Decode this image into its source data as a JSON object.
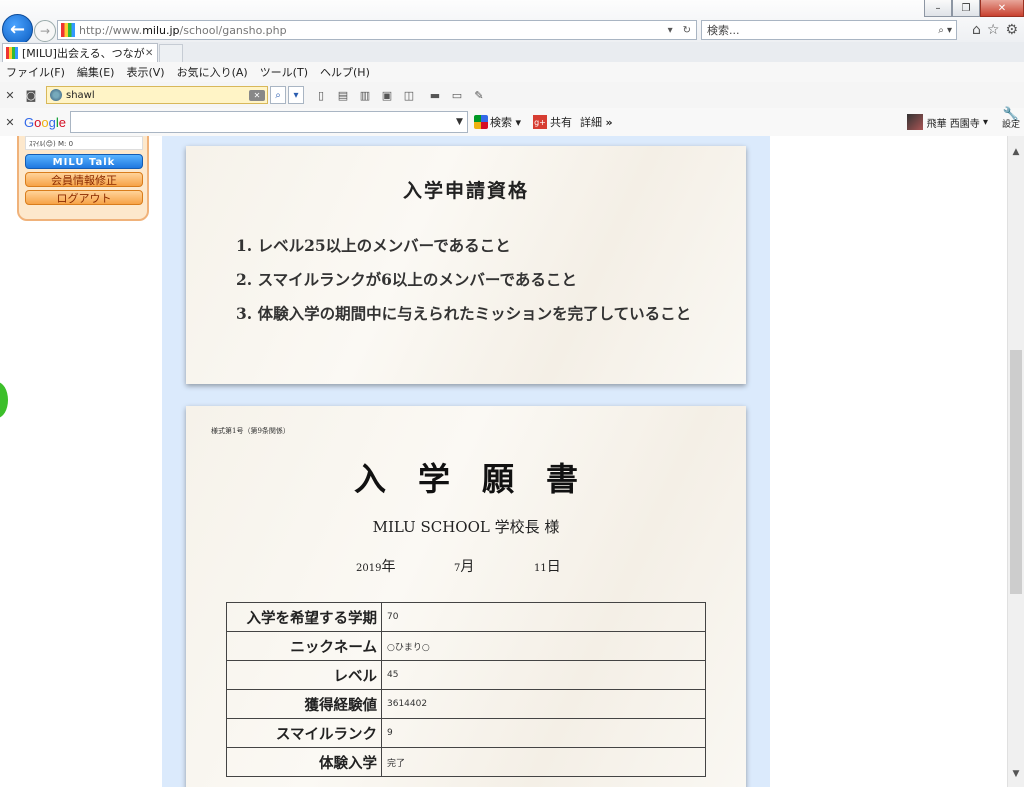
{
  "browser": {
    "url_prefix": "http://www.",
    "url_domain": "milu.jp",
    "url_path": "/school/gansho.php",
    "search_placeholder": "検索...",
    "tab_title": "[MILU]出会える、つなが...",
    "menu": [
      "ファイル(F)",
      "編集(E)",
      "表示(V)",
      "お気に入り(A)",
      "ツール(T)",
      "ヘルプ(H)"
    ],
    "toolbar_search_value": "shawl",
    "google": {
      "search_label": "検索",
      "share_label": "共有",
      "details_label": "詳細",
      "user_name": "飛華 西園寺",
      "settings_label": "設定"
    }
  },
  "sidebar": {
    "smile_field": "ｽﾏｲﾙ(😊) M: 0",
    "talk_button": "MILU Talk",
    "edit_button": "会員情報修正",
    "logout_button": "ログアウト"
  },
  "requirements": {
    "title": "入学申請資格",
    "items": [
      "1. レベル25以上のメンバーであること",
      "2. スマイルランクが6以上のメンバーであること",
      "3. 体験入学の期間中に与えられたミッションを完了していること"
    ]
  },
  "application": {
    "form_no": "様式第1号（第9条関係）",
    "title": "入学願書",
    "recipient": "MILU SCHOOL 学校長 様",
    "date": {
      "year": "2019",
      "year_unit": "年",
      "month": "7",
      "month_unit": "月",
      "day": "11",
      "day_unit": "日"
    },
    "rows": [
      {
        "label": "入学を希望する学期",
        "value": "70"
      },
      {
        "label": "ニックネーム",
        "value": "○ひまり○"
      },
      {
        "label": "レベル",
        "value": "45"
      },
      {
        "label": "獲得経験値",
        "value": "3614402"
      },
      {
        "label": "スマイルランク",
        "value": "9"
      },
      {
        "label": "体験入学",
        "value": "完了"
      }
    ]
  }
}
